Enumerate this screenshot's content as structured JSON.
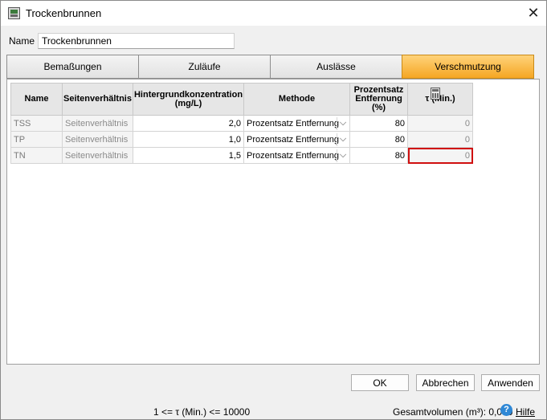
{
  "window": {
    "title": "Trockenbrunnen",
    "close_glyph": "✕",
    "icon": "dry-well-icon"
  },
  "name_field": {
    "label": "Name",
    "value": "Trockenbrunnen"
  },
  "tabs": [
    {
      "label": "Bemaßungen",
      "active": false
    },
    {
      "label": "Zuläufe",
      "active": false
    },
    {
      "label": "Auslässe",
      "active": false
    },
    {
      "label": "Verschmutzung",
      "active": true
    }
  ],
  "table": {
    "headers": {
      "name": "Name",
      "ratio": "Seitenverhältnis",
      "background": "Hintergrundkonzentration (mg/L)",
      "method": "Methode",
      "percent": "Prozentsatz Entfernung (%)",
      "tau": "τ (Min.)"
    },
    "rows": [
      {
        "name": "TSS",
        "ratio": "Seitenverhältnis",
        "background": "2,0",
        "method": "Prozentsatz Entfernung",
        "percent": "80",
        "tau": "0"
      },
      {
        "name": "TP",
        "ratio": "Seitenverhältnis",
        "background": "1,0",
        "method": "Prozentsatz Entfernung",
        "percent": "80",
        "tau": "0"
      },
      {
        "name": "TN",
        "ratio": "Seitenverhältnis",
        "background": "1,5",
        "method": "Prozentsatz Entfernung",
        "percent": "80",
        "tau": "0"
      }
    ],
    "chevron_glyph": "⌵",
    "highlight_color": "#d01010",
    "calculator_icon": "calculator-icon"
  },
  "buttons": {
    "ok": "OK",
    "cancel": "Abbrechen",
    "apply": "Anwenden"
  },
  "status": {
    "range_hint": "1 <= τ (Min.) <= 10000",
    "total_volume": "Gesamtvolumen (m³): 0,000",
    "help_glyph": "?",
    "help_label": "Hilfe"
  },
  "colors": {
    "active_tab": "#f5a623",
    "help_icon": "#2f88d6"
  }
}
